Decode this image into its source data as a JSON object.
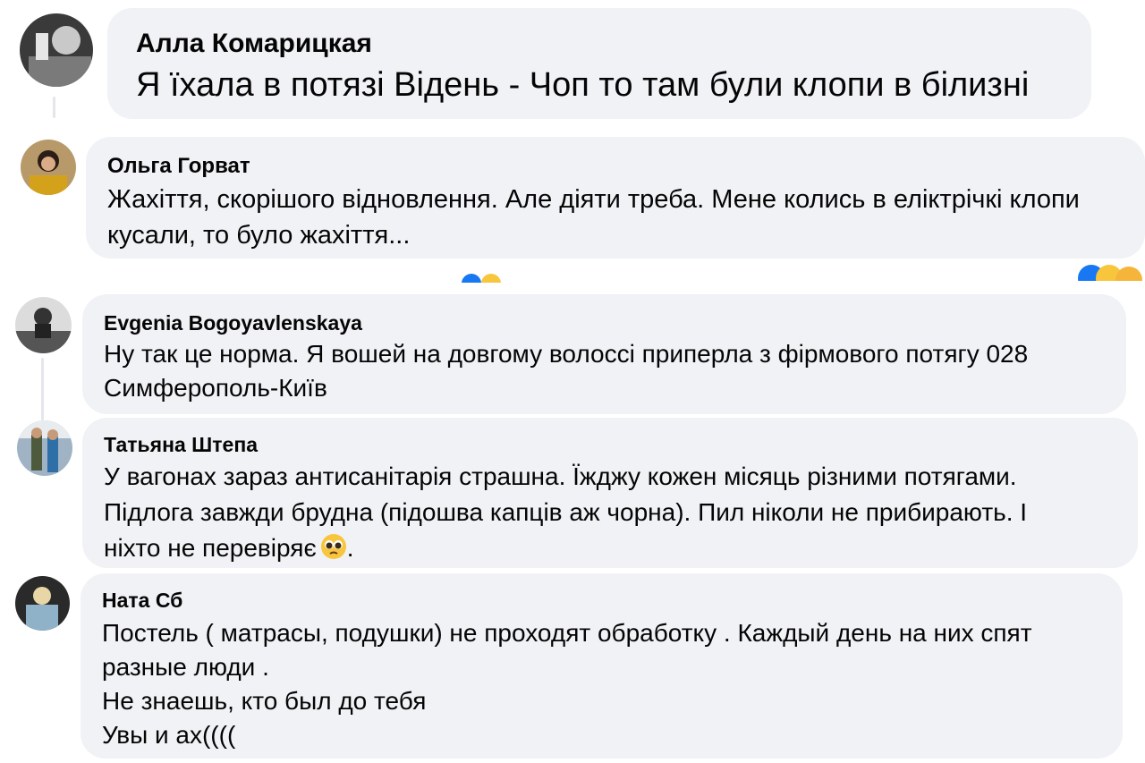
{
  "comments": [
    {
      "author": "Алла Комарицкая",
      "lines": [
        "Я їхала в потязі Відень - Чоп то там були клопи в білизні"
      ]
    },
    {
      "author": "Ольга Горват",
      "lines": [
        "Жахіття, скорішого відновлення. Але діяти треба. Мене колись в еліктрічкі клопи",
        "кусали, то було жахіття..."
      ]
    },
    {
      "author": "Evgenia Bogoyavlenskaya",
      "lines": [
        "Ну так це норма. Я вошей на довгому волоссі приперла з фірмового потягу 028",
        "Симферополь-Київ"
      ]
    },
    {
      "author": "Татьяна Штепа",
      "lines": [
        "У вагонах зараз антисанітарія страшна. Їжджу кожен місяць різними потягами.",
        "Підлога завжди брудна (підошва капців аж чорна). Пил ніколи не прибирають. І",
        "ніхто не перевіряє"
      ]
    },
    {
      "author": "Ната Сб",
      "lines": [
        "Постель ( матрасы, подушки) не проходят обработку . Каждый день на них спят",
        "разные люди .",
        "Не знаешь, кто был до тебя",
        "Увы и ах(((("
      ]
    }
  ],
  "icons": {
    "pleading_emoji": "pleading-face-emoji",
    "reaction_like": "like-reaction-icon",
    "reaction_haha": "haha-reaction-icon"
  },
  "colors": {
    "bubble": "#f0f2f5",
    "text": "#050505",
    "thread_line": "#e4e6eb",
    "like_blue": "#1877f2",
    "emoji_yellow": "#f7c63d"
  }
}
